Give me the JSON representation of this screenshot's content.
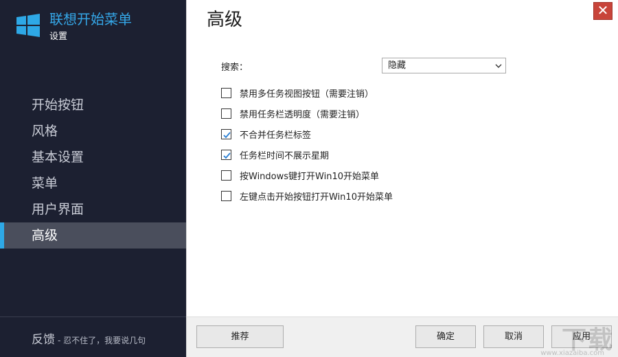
{
  "app": {
    "title": "联想开始菜单",
    "subtitle": "设置",
    "accent": "#35a7e8"
  },
  "sidebar": {
    "items": [
      {
        "label": "开始按钮",
        "active": false
      },
      {
        "label": "风格",
        "active": false
      },
      {
        "label": "基本设置",
        "active": false
      },
      {
        "label": "菜单",
        "active": false
      },
      {
        "label": "用户界面",
        "active": false
      },
      {
        "label": "高级",
        "active": true
      }
    ],
    "feedback_label": "反馈",
    "feedback_note": "- 忍不住了，我要说几句"
  },
  "main": {
    "title": "高级",
    "close_glyph": "✕",
    "search_label": "搜索：",
    "search_value": "隐藏",
    "options": [
      {
        "label": "禁用多任务视图按钮（需要注销）",
        "checked": false
      },
      {
        "label": "禁用任务栏透明度（需要注销）",
        "checked": false
      },
      {
        "label": "不合并任务栏标签",
        "checked": true
      },
      {
        "label": "任务栏时间不展示星期",
        "checked": true
      },
      {
        "label": "按Windows键打开Win10开始菜单",
        "checked": false
      },
      {
        "label": "左键点击开始按钮打开Win10开始菜单",
        "checked": false
      }
    ]
  },
  "footer": {
    "recommend": "推荐",
    "ok": "确定",
    "cancel": "取消",
    "apply": "应用"
  },
  "watermark": {
    "text": "下载",
    "url": "www.xiazaiba.com"
  }
}
